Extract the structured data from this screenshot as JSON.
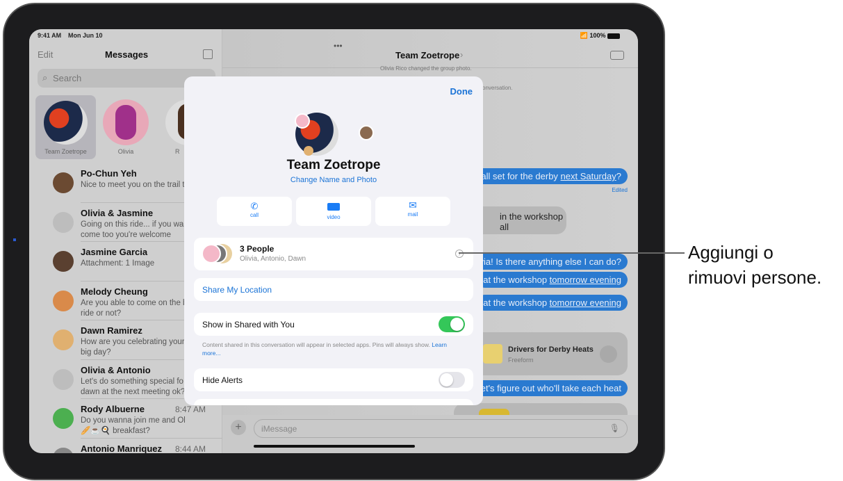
{
  "status_bar": {
    "time": "9:41 AM",
    "date": "Mon Jun 10",
    "battery": "100%"
  },
  "sidebar": {
    "edit": "Edit",
    "title": "Messages",
    "search_placeholder": "Search",
    "pinned": [
      {
        "label": "Team Zoetrope"
      },
      {
        "label": "Olivia"
      },
      {
        "label": "R"
      }
    ],
    "conversations": [
      {
        "name": "Po-Chun Yeh",
        "preview": "Nice to meet you on the trail t",
        "time": "",
        "color": "#6b4a32"
      },
      {
        "name": "Olivia & Jasmine",
        "preview": "Going on this ride... if you wan\ncome too you're welcome",
        "time": "",
        "color": "#bdbdbd"
      },
      {
        "name": "Jasmine Garcia",
        "preview": "Attachment: 1 Image",
        "time": "",
        "color": "#5a4030"
      },
      {
        "name": "Melody Cheung",
        "preview": "Are you able to come on the b\nride or not?",
        "time": "",
        "color": "#d98a4a"
      },
      {
        "name": "Dawn Ramirez",
        "preview": "How are you celebrating your\nbig day?",
        "time": "",
        "color": "#e0b070"
      },
      {
        "name": "Olivia & Antonio",
        "preview": "Let's do something special fo\ndawn at the next meeting ok?",
        "time": "",
        "color": "#bdbdbd"
      },
      {
        "name": "Rody Albuerne",
        "preview": "Do you wanna join me and Oli for\n🥖☕🍳 breakfast?",
        "time": "8:47 AM",
        "color": "#4caf50"
      },
      {
        "name": "Antonio Manriquez",
        "preview": "",
        "time": "8:44 AM",
        "color": "#888"
      }
    ]
  },
  "chat": {
    "title": "Team Zoetrope",
    "system1": "Olivia Rico changed the group photo.",
    "system2": "onversation.",
    "messages": [
      {
        "pre": "all set for the derby ",
        "link": "next Saturday",
        "post": "?"
      },
      {
        "pre": "ivia! Is there anything else I can do?",
        "link": "",
        "post": ""
      },
      {
        "pre": "at the workshop ",
        "link": "tomorrow evening",
        "post": ""
      },
      {
        "pre": "at the workshop ",
        "link": "tomorrow evening",
        "post": ""
      },
      {
        "pre": "et's figure out who'll take each heat",
        "link": "",
        "post": ""
      }
    ],
    "edited": "Edited",
    "gray_message": "in the workshop all",
    "freeform": {
      "title": "Drivers for Derby Heats",
      "subtitle": "Freeform"
    },
    "input_placeholder": "iMessage"
  },
  "modal": {
    "done": "Done",
    "group_name": "Team Zoetrope",
    "change": "Change Name and Photo",
    "actions": [
      {
        "label": "call",
        "icon": "phone-icon"
      },
      {
        "label": "video",
        "icon": "video-icon"
      },
      {
        "label": "mail",
        "icon": "mail-icon"
      }
    ],
    "people_title": "3 People",
    "people_names": "Olivia, Antonio, Dawn",
    "share_location": "Share My Location",
    "shared_with_you": "Show in Shared with You",
    "shared_with_you_on": true,
    "shared_note": "Content shared in this conversation will appear in selected apps. Pins will always show.",
    "learn_more": "Learn more...",
    "hide_alerts": "Hide Alerts",
    "hide_alerts_on": false
  },
  "callout": {
    "line1": "Aggiungi o",
    "line2": "rimuovi persone."
  },
  "colors": {
    "accent": "#1a7cf5",
    "toggle_on": "#34c759",
    "bubble": "#2a7ad0"
  }
}
